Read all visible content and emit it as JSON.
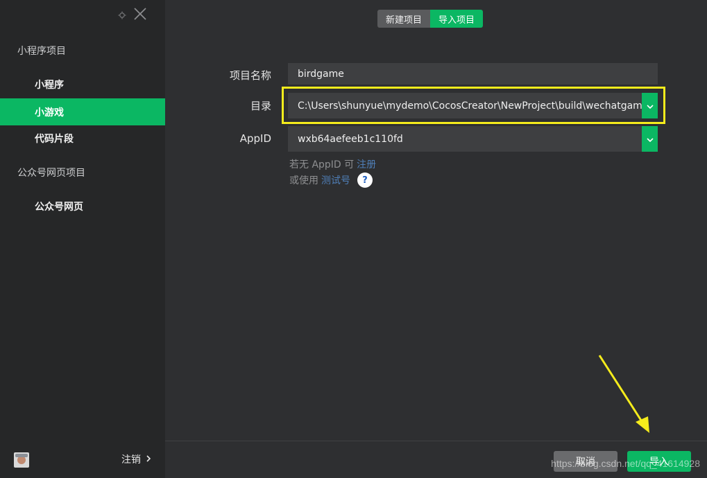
{
  "sidebar": {
    "groups": [
      {
        "title": "小程序项目"
      },
      {
        "title": "公众号网页项目"
      }
    ],
    "items": [
      {
        "label": "小程序",
        "active": false
      },
      {
        "label": "小游戏",
        "active": true
      },
      {
        "label": "代码片段",
        "active": false
      },
      {
        "label": "公众号网页",
        "active": false
      }
    ],
    "logout_label": "注销"
  },
  "tabs": [
    {
      "label": "新建项目",
      "active": false
    },
    {
      "label": "导入项目",
      "active": true
    }
  ],
  "form": {
    "name_label": "项目名称",
    "name_value": "birdgame",
    "dir_label": "目录",
    "dir_value": "C:\\Users\\shunyue\\mydemo\\CocosCreator\\NewProject\\build\\wechatgame",
    "appid_label": "AppID",
    "appid_value": "wxb64aefeeb1c110fd"
  },
  "hints": {
    "no_appid_prefix": "若无 AppID 可",
    "register_link": "注册",
    "or_use_prefix": "或使用",
    "test_account_link": "测试号",
    "help_symbol": "?"
  },
  "buttons": {
    "cancel_label": "取消",
    "import_label": "导入"
  },
  "watermark": "https://blog.csdn.net/qq_41614928",
  "colors": {
    "accent": "#0bb763",
    "highlight": "#f5ec1c",
    "background": "#2e2f31",
    "sidebar": "#262728"
  }
}
